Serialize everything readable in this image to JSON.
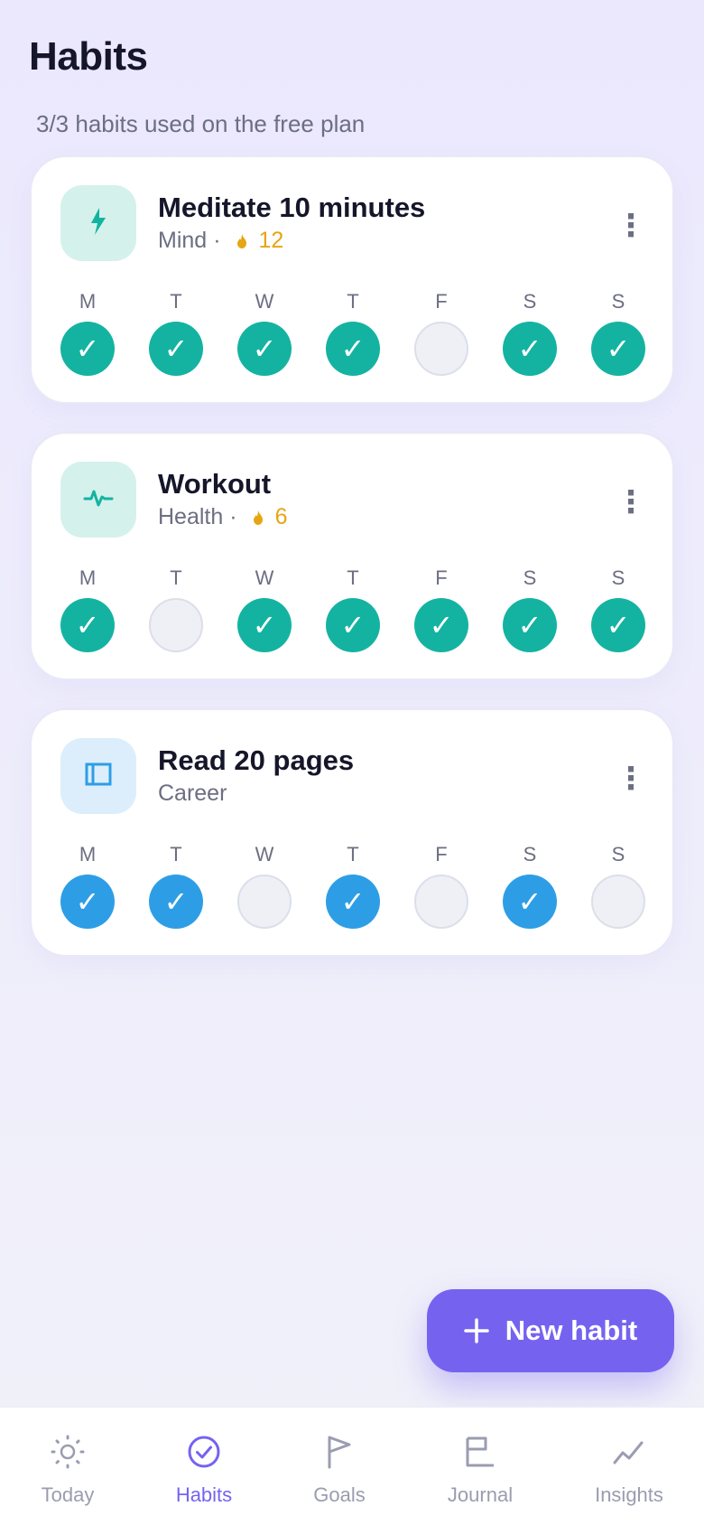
{
  "header": {
    "title": "Habits",
    "plan_note": "3/3 habits used on the free plan"
  },
  "habits": [
    {
      "name": "Meditate 10 minutes",
      "category": "Mind",
      "separator": "·",
      "streak": "12",
      "icon": "bolt-icon",
      "accent": "#14b3a1",
      "days": [
        {
          "label": "M",
          "done": true
        },
        {
          "label": "T",
          "done": true
        },
        {
          "label": "W",
          "done": true
        },
        {
          "label": "T",
          "done": true
        },
        {
          "label": "F",
          "done": false
        },
        {
          "label": "S",
          "done": true
        },
        {
          "label": "S",
          "done": true
        }
      ]
    },
    {
      "name": "Workout",
      "category": "Health",
      "separator": "·",
      "streak": "6",
      "icon": "pulse-icon",
      "accent": "#14b3a1",
      "days": [
        {
          "label": "M",
          "done": true
        },
        {
          "label": "T",
          "done": false
        },
        {
          "label": "W",
          "done": true
        },
        {
          "label": "T",
          "done": true
        },
        {
          "label": "F",
          "done": true
        },
        {
          "label": "S",
          "done": true
        },
        {
          "label": "S",
          "done": true
        }
      ]
    },
    {
      "name": "Read 20 pages",
      "category": "Career",
      "icon": "book-icon",
      "accent": "#2d9ee6",
      "days": [
        {
          "label": "M",
          "done": true
        },
        {
          "label": "T",
          "done": true
        },
        {
          "label": "W",
          "done": false
        },
        {
          "label": "T",
          "done": true
        },
        {
          "label": "F",
          "done": false
        },
        {
          "label": "S",
          "done": true
        },
        {
          "label": "S",
          "done": false
        }
      ]
    }
  ],
  "check_mark": "✓",
  "more_glyph": "⋮",
  "fab": {
    "label": "New habit",
    "icon": "plus-icon"
  },
  "nav": [
    {
      "label": "Today",
      "icon": "sun-icon",
      "active": false
    },
    {
      "label": "Habits",
      "icon": "check-circle-icon",
      "active": true
    },
    {
      "label": "Goals",
      "icon": "flag-icon",
      "active": false
    },
    {
      "label": "Journal",
      "icon": "journal-icon",
      "active": false
    },
    {
      "label": "Insights",
      "icon": "trend-icon",
      "active": false
    }
  ],
  "colors": {
    "brand": "#7563f0",
    "done_green": "#14b3a1",
    "done_blue": "#2d9ee6",
    "streak": "#e6a512"
  }
}
